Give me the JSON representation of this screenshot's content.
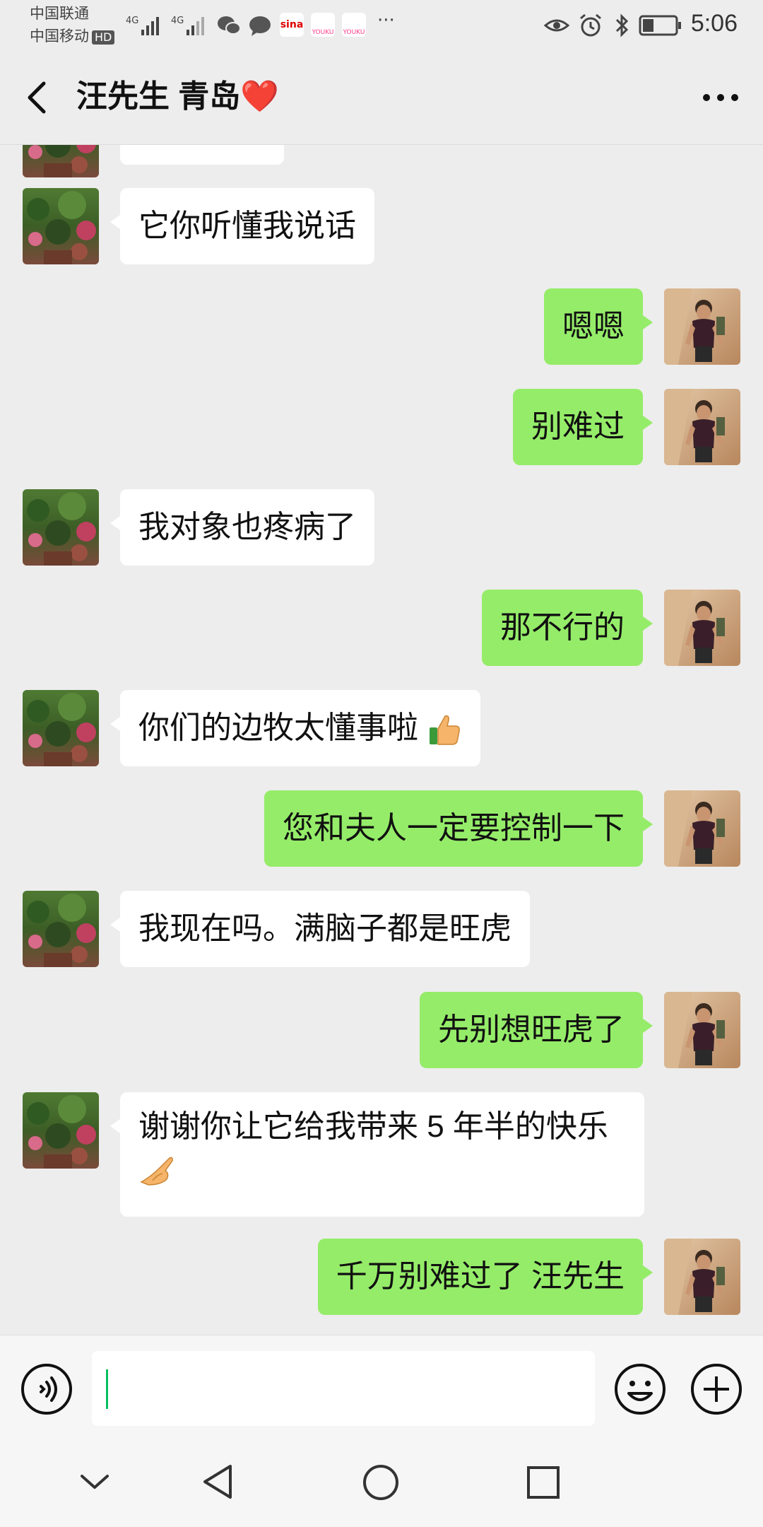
{
  "status_bar": {
    "carrier_1": "中国联通",
    "carrier_2": "中国移动",
    "hd_label": "HD",
    "network_1": "4G",
    "network_2": "4G",
    "sina_label": "sina",
    "youku_label": "YOUKU",
    "more_dots": "···",
    "time": "5:06",
    "battery_level": 0.35
  },
  "header": {
    "title": "汪先生 青岛❤️"
  },
  "messages": [
    {
      "side": "in",
      "text": ""
    },
    {
      "side": "in",
      "text": "它你听懂我说话"
    },
    {
      "side": "out",
      "text": "嗯嗯"
    },
    {
      "side": "out",
      "text": "别难过"
    },
    {
      "side": "in",
      "text": "我对象也疼病了"
    },
    {
      "side": "out",
      "text": "那不行的"
    },
    {
      "side": "in",
      "text": "你们的边牧太懂事啦",
      "emoji": "thumbs-up"
    },
    {
      "side": "out",
      "text": "您和夫人一定要控制一下"
    },
    {
      "side": "in",
      "text": "我现在吗。满脑子都是旺虎"
    },
    {
      "side": "out",
      "text": "先别想旺虎了"
    },
    {
      "side": "in",
      "text": "谢谢你让它给我带来 5 年半的快乐",
      "emoji": "ok-hand"
    },
    {
      "side": "out",
      "text": "千万别难过了 汪先生"
    }
  ],
  "input": {
    "value": "",
    "placeholder": ""
  },
  "colors": {
    "background": "#ededed",
    "bubble_out": "#95ec69",
    "bubble_in": "#ffffff",
    "caret": "#07c160"
  }
}
